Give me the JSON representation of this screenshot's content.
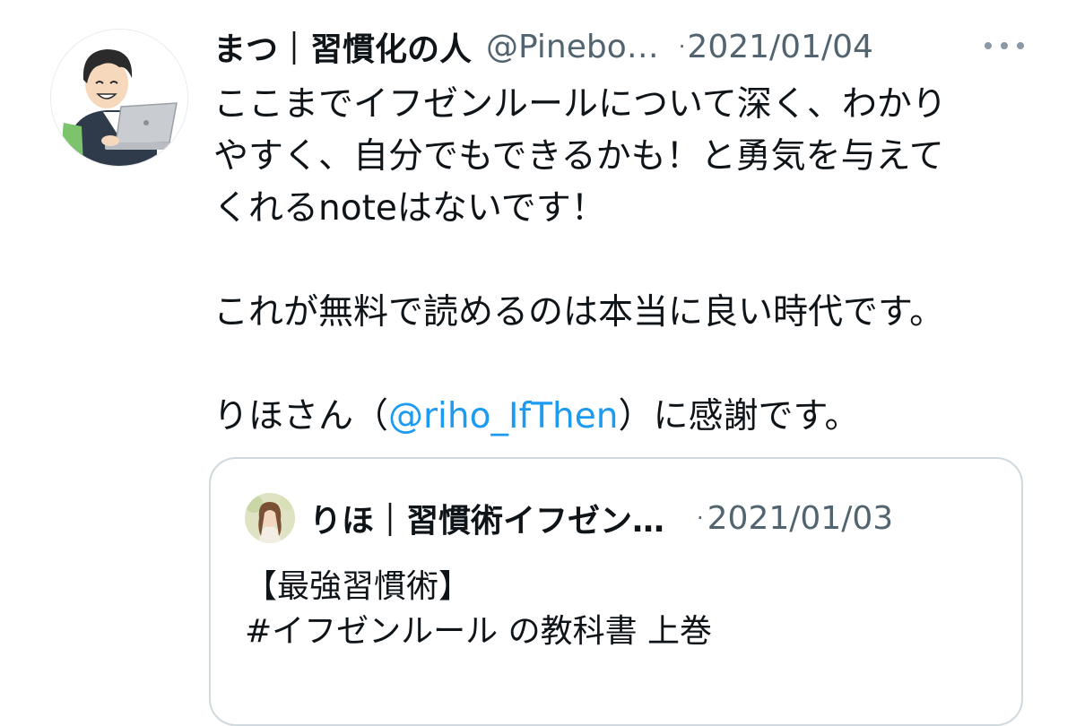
{
  "tweet": {
    "display_name": "まつ｜習慣化の人",
    "handle": "@Pinebo…",
    "separator": "·",
    "date": "2021/01/04",
    "body": {
      "line1": "ここまでイフゼンルールについて深く、わかり",
      "line2": "やすく、自分でもできるかも！と勇気を与えて",
      "line3": "くれるnoteはないです！",
      "line4": "これが無料で読めるのは本当に良い時代です。",
      "line5_prefix": "りほさん（",
      "line5_mention": "@riho_IfThen",
      "line5_suffix": "）に感謝です。"
    }
  },
  "quote": {
    "display_name": "りほ｜習慣術イフゼン…",
    "separator": "·",
    "date": "2021/01/03",
    "text": {
      "line1": "【最強習慣術】",
      "line2": "#イフゼンルール の教科書 上巻"
    }
  },
  "icons": {
    "more": "more-options-icon"
  },
  "colors": {
    "text": "#0f1419",
    "secondary": "#536471",
    "link": "#1d9bf0",
    "border": "#cfd9de"
  }
}
